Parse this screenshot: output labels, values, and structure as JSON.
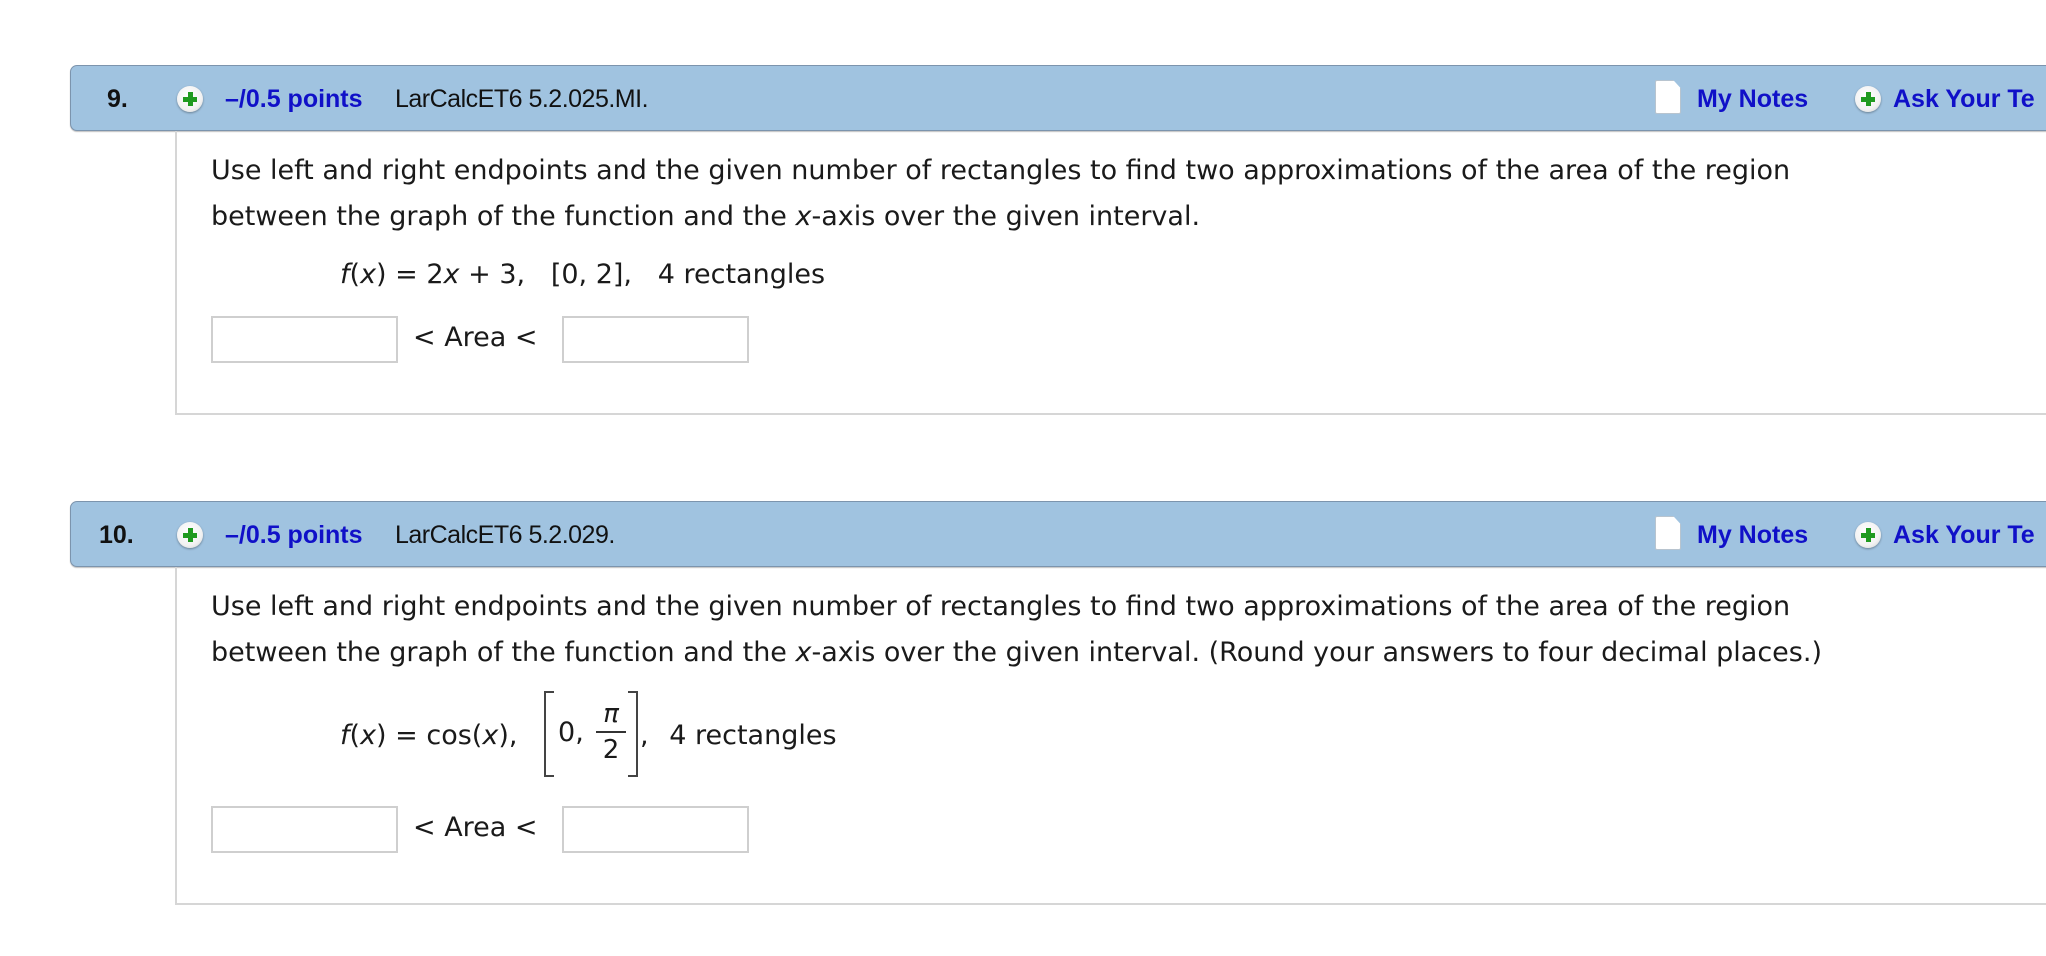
{
  "questions": [
    {
      "number": "9.",
      "points": "–/0.5 points",
      "code": "LarCalcET6 5.2.025.MI.",
      "my_notes": "My Notes",
      "ask": "Ask Your Te",
      "prompt_line1": "Use left and right endpoints and the given number of rectangles to find two approximations of the area of the region",
      "prompt_line2_pre": "between the graph of the function and the ",
      "prompt_line2_var": "x",
      "prompt_line2_post": "-axis over the given interval.",
      "formula": {
        "f": "f",
        "x": "x",
        "eq": ") = 2",
        "x2": "x",
        "rest": " + 3,   [0, 2],   4 rectangles"
      },
      "area_label": "< Area <",
      "lower_value": "",
      "upper_value": ""
    },
    {
      "number": "10.",
      "points": "–/0.5 points",
      "code": "LarCalcET6 5.2.029.",
      "my_notes": "My Notes",
      "ask": "Ask Your Te",
      "prompt_line1": "Use left and right endpoints and the given number of rectangles to find two approximations of the area of the region",
      "prompt_line2_pre": "between the graph of the function and the ",
      "prompt_line2_var": "x",
      "prompt_line2_post": "-axis over the given interval. (Round your answers to four decimal places.)",
      "formula": {
        "f": "f",
        "x": "x",
        "eq": ") = cos(",
        "x2": "x",
        "close": "),",
        "interval_start": "0,",
        "interval_num": "π",
        "interval_den": "2",
        "comma": ",",
        "rest": "4 rectangles"
      },
      "area_label": "< Area <",
      "lower_value": "",
      "upper_value": ""
    }
  ],
  "icons": {
    "expand": "plus-circle-icon",
    "notes": "document-icon"
  },
  "colors": {
    "header_bg": "#a0c3e0",
    "link": "#1010c8",
    "plus_green": "#1f9a1f"
  }
}
